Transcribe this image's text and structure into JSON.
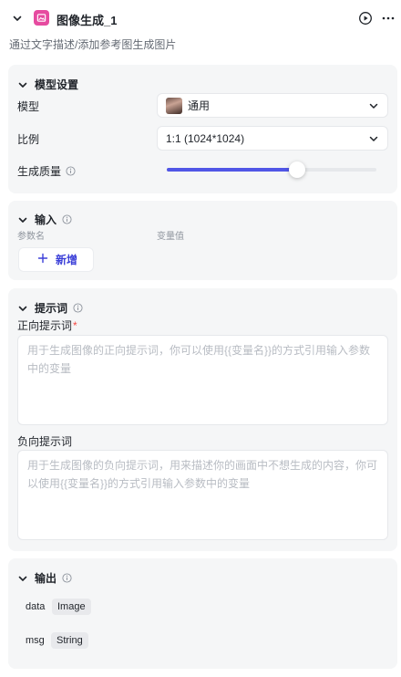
{
  "header": {
    "title": "图像生成_1",
    "description": "通过文字描述/添加参考图生成图片"
  },
  "model_settings": {
    "title": "模型设置",
    "model_label": "模型",
    "model_value": "通用",
    "ratio_label": "比例",
    "ratio_value": "1:1 (1024*1024)",
    "quality_label": "生成质量",
    "quality_level": 0.62
  },
  "input": {
    "title": "输入",
    "col_param": "参数名",
    "col_value": "变量值",
    "add_label": "新增"
  },
  "prompt": {
    "title": "提示词",
    "positive_label": "正向提示词",
    "required_mark": "*",
    "positive_placeholder": "用于生成图像的正向提示词，你可以使用{{变量名}}的方式引用输入参数中的变量",
    "negative_label": "负向提示词",
    "negative_placeholder": "用于生成图像的负向提示词，用来描述你的画面中不想生成的内容，你可以使用{{变量名}}的方式引用输入参数中的变量"
  },
  "output": {
    "title": "输出",
    "items": [
      {
        "key": "data",
        "type": "Image"
      },
      {
        "key": "msg",
        "type": "String"
      }
    ]
  },
  "colors": {
    "accent": "#5156e6",
    "app_icon": "#e64ba0",
    "card_bg": "#f5f6f7"
  }
}
